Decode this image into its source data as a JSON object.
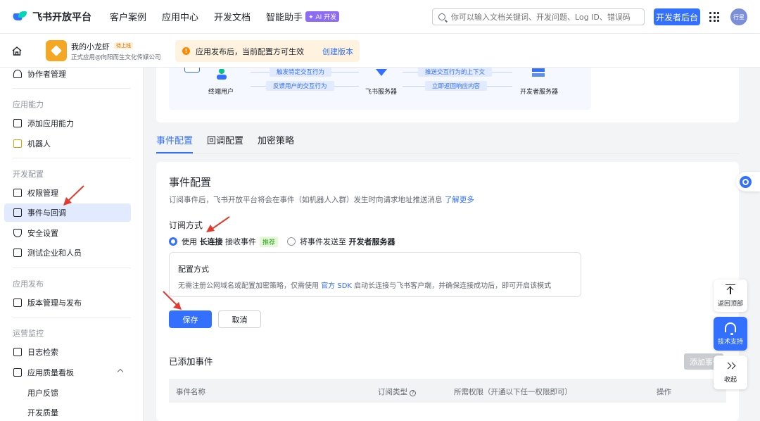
{
  "header": {
    "logo_text": "飞书开放平台",
    "nav": [
      "客户案例",
      "应用中心",
      "开发文档",
      "智能助手"
    ],
    "ai_badge": "✦ AI 开发",
    "search_placeholder": "你可以输入文档关键词、开发问题、Log ID、错误码",
    "dev_console_label": "开发者后台",
    "avatar_text": "行星"
  },
  "appbar": {
    "app_name": "我的小龙虾",
    "app_badge": "待上线",
    "app_sub": "正式应用@向阳而生文化传媒公司",
    "notice_text": "应用发布后，当前配置方可生效",
    "notice_link": "创建版本"
  },
  "sidebar": {
    "items": [
      {
        "label": "协作者管理"
      },
      {
        "label": "应用能力",
        "group": true
      },
      {
        "label": "添加应用能力"
      },
      {
        "label": "机器人"
      },
      {
        "label": "开发配置",
        "group": true
      },
      {
        "label": "权限管理"
      },
      {
        "label": "事件与回调",
        "active": true
      },
      {
        "label": "安全设置"
      },
      {
        "label": "测试企业和人员"
      },
      {
        "label": "应用发布",
        "group": true
      },
      {
        "label": "版本管理与发布"
      },
      {
        "label": "运营监控",
        "group": true
      },
      {
        "label": "日志检索"
      },
      {
        "label": "应用质量看板"
      },
      {
        "label": "用户反馈"
      },
      {
        "label": "开发质量"
      }
    ]
  },
  "diagram": {
    "end_user": "终端用户",
    "feishu_server": "飞书服务器",
    "dev_server": "开发者服务器",
    "flow_trigger": "触发特定交互行为",
    "flow_feedback": "反馈用户的交互行为",
    "flow_push": "推送交互行为的上下文",
    "flow_return": "立即返回响应内容"
  },
  "tabs": [
    "事件配置",
    "回调配置",
    "加密策略"
  ],
  "config": {
    "title": "事件配置",
    "desc": "订阅事件后，飞书开放平台将会在事件（如机器人入群）发生时向请求地址推送消息",
    "learn_more": "了解更多",
    "mode_title": "订阅方式",
    "opt1_pre": "使用",
    "opt1_bold": "长连接",
    "opt1_post": "接收事件",
    "opt1_tag": "推荐",
    "opt2_pre": "将事件发送至",
    "opt2_bold": "开发者服务器",
    "box_title": "配置方式",
    "box_text_pre": "无需注册公网域名或配置加密策略，仅需使用",
    "box_link": "官方 SDK",
    "box_text_post": "启动长连接与飞书客户端，并确保连接成功后，即可开启该模式",
    "save": "保存",
    "cancel": "取消"
  },
  "events": {
    "title": "已添加事件",
    "add_button": "添加事件",
    "columns": [
      "事件名称",
      "订阅类型",
      "所需权限（开通以下任一权限即可）",
      "操作"
    ]
  },
  "float": {
    "back_top": "返回顶部",
    "support": "技术支持",
    "collapse": "收起"
  },
  "colors": {
    "accent": "#3370ff",
    "annotation_arrow": "#e23b2e"
  }
}
